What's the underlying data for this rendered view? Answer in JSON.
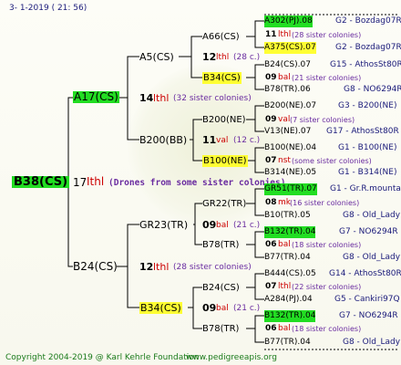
{
  "header": "3-  1-2019 ( 21:  56)",
  "root": {
    "name": "B38(CS)",
    "gen": "17",
    "sign": "Ithl",
    "note": "(Drones from some sister colonies)"
  },
  "gen1": {
    "a": {
      "name": "A17(CS)",
      "gen": "14",
      "sign": "lthl",
      "note": "(32 sister colonies)"
    },
    "b": {
      "name": "B24(CS)",
      "gen": "12",
      "sign": "lthl",
      "note": "(28 sister colonies)"
    }
  },
  "gen2": [
    {
      "name": "A5(CS)",
      "gen": "12",
      "sign": "lthl",
      "note": "(28 c.)"
    },
    {
      "name": "B200(BB)",
      "gen": "11",
      "sign": "val",
      "note": "(12 c.)"
    },
    {
      "name": "GR23(TR)",
      "gen": "09",
      "sign": "bal",
      "note": "(21 c.)"
    },
    {
      "name": "B34(CS)",
      "gen": "09",
      "sign": "bal",
      "note": "(21 c.)"
    }
  ],
  "gen3": [
    "A66(CS)",
    "B34(CS)",
    "B200(NE)",
    "B100(NE)",
    "GR22(TR)",
    "B78(TR)",
    "B24(CS)",
    "B78(TR)"
  ],
  "gen4": [
    {
      "top": "A302(PJ).08",
      "gen": "11",
      "sign": "lthl",
      "note": "(28 sister colonies)",
      "bot": "A375(CS).07",
      "topMid": "G2 - Bozdag07R",
      "botMid": "G2 - Bozdag07R"
    },
    {
      "top": "B24(CS).07",
      "gen": "09",
      "sign": "bal",
      "note": "(21 sister colonies)",
      "bot": "B78(TR).06",
      "topMid": "G15 - AthosSt80R",
      "botMid": "G8 - NO6294R"
    },
    {
      "top": "B200(NE).07",
      "gen": "09",
      "sign": "val",
      "note": "(7 sister colonies)",
      "bot": "V13(NE).07",
      "topMid": "G3 - B200(NE)",
      "botMid": "G17 - AthosSt80R"
    },
    {
      "top": "B100(NE).04",
      "gen": "07",
      "sign": "nst",
      "note": "(some sister colonies)",
      "bot": "B314(NE).05",
      "topMid": "G1 - B100(NE)",
      "botMid": "G1 - B314(NE)"
    },
    {
      "top": "GR51(TR).07",
      "gen": "08",
      "sign": "mk",
      "note": "(16 sister colonies)",
      "bot": "B10(TR).05",
      "topMid": "G1 - Gr.R.mounta",
      "botMid": "G8 - Old_Lady"
    },
    {
      "top": "B132(TR).04",
      "gen": "06",
      "sign": "bal",
      "note": "(18 sister colonies)",
      "bot": "B77(TR).04",
      "topMid": "G7 - NO6294R",
      "botMid": "G8 - Old_Lady"
    },
    {
      "top": "B444(CS).05",
      "gen": "07",
      "sign": "lthl",
      "note": "(22 sister colonies)",
      "bot": "A284(PJ).04",
      "topMid": "G14 - AthosSt80R",
      "botMid": "G5 - Cankiri97Q"
    },
    {
      "top": "B132(TR).04",
      "gen": "06",
      "sign": "bal",
      "note": "(18 sister colonies)",
      "bot": "B77(TR).04",
      "topMid": "G7 - NO6294R",
      "botMid": "G8 - Old_Lady"
    }
  ],
  "footer": {
    "copyright": "Copyright 2004-2019 @ Karl Kehrle Foundation",
    "url": "www.pedigreeapis.org"
  }
}
